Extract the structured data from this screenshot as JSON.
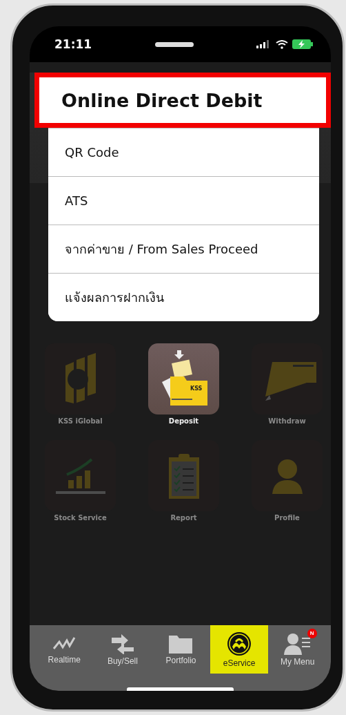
{
  "status_bar": {
    "time": "21:11"
  },
  "menu": {
    "items": [
      {
        "label": "Online Direct Debit",
        "highlighted": true
      },
      {
        "label": "QR Code",
        "highlighted": false
      },
      {
        "label": "ATS",
        "highlighted": false
      },
      {
        "label": "จากค่าขาย / From Sales Proceed",
        "highlighted": false
      },
      {
        "label": "แจ้งผลการฝากเงิน",
        "highlighted": false
      }
    ]
  },
  "tiles": [
    {
      "label": "KSS iGlobal",
      "kind": "globe",
      "selected": false
    },
    {
      "label": "Deposit",
      "kind": "folder",
      "selected": true,
      "emblem": "KSS"
    },
    {
      "label": "Withdraw",
      "kind": "card",
      "selected": false
    },
    {
      "label": "Stock Service",
      "kind": "chart",
      "selected": false
    },
    {
      "label": "Report",
      "kind": "clipboard",
      "selected": false
    },
    {
      "label": "Profile",
      "kind": "person",
      "selected": false
    }
  ],
  "tab_bar": {
    "tabs": [
      {
        "label": "Realtime",
        "kind": "line",
        "selected": false
      },
      {
        "label": "Buy/Sell",
        "kind": "arrows",
        "selected": false
      },
      {
        "label": "Portfolio",
        "kind": "folder",
        "selected": false
      },
      {
        "label": "eService",
        "kind": "logo",
        "selected": true
      },
      {
        "label": "My Menu",
        "kind": "user",
        "selected": false,
        "badge": "N"
      }
    ]
  }
}
